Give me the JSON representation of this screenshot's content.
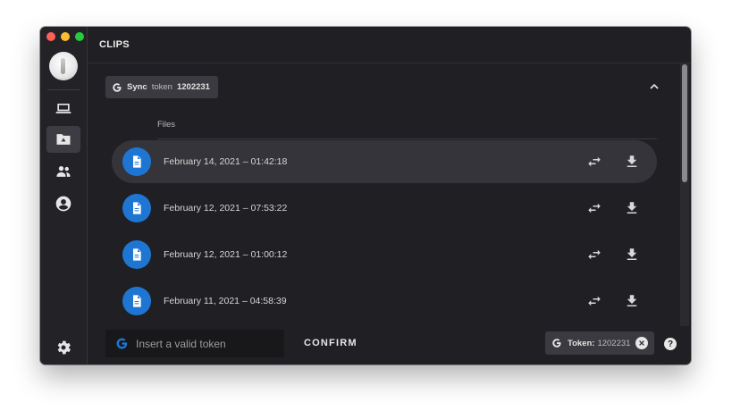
{
  "window": {
    "title": "CLIPS",
    "traffic_lights": [
      "close",
      "minimize",
      "zoom"
    ]
  },
  "sidebar": {
    "items": [
      {
        "name": "devices",
        "icon": "laptop-icon",
        "active": false
      },
      {
        "name": "drive",
        "icon": "drive-folder-icon",
        "active": true
      },
      {
        "name": "people",
        "icon": "people-icon",
        "active": false
      },
      {
        "name": "account",
        "icon": "account-circle-icon",
        "active": false
      }
    ],
    "settings_icon": "gear-icon"
  },
  "sync": {
    "label_bold": "Sync",
    "label_light": "token",
    "token": "1202231"
  },
  "files": {
    "header": "Files",
    "items": [
      {
        "name": "February 14, 2021 – 01:42:18",
        "selected": true
      },
      {
        "name": "February 12, 2021 – 07:53:22",
        "selected": false
      },
      {
        "name": "February 12, 2021 – 01:00:12",
        "selected": false
      },
      {
        "name": "February 11, 2021 – 04:58:39",
        "selected": false
      }
    ]
  },
  "bottom": {
    "input_placeholder": "Insert a valid token",
    "confirm_label": "CONFIRM",
    "token_label": "Token:",
    "token_value": "1202231",
    "help_label": "?"
  },
  "colors": {
    "background": "#202024",
    "sidebar": "#232327",
    "selected_row": "#34343a",
    "chip": "#3a3a40",
    "file_avatar": "#1f76d2",
    "text": "#d6d6d6"
  }
}
